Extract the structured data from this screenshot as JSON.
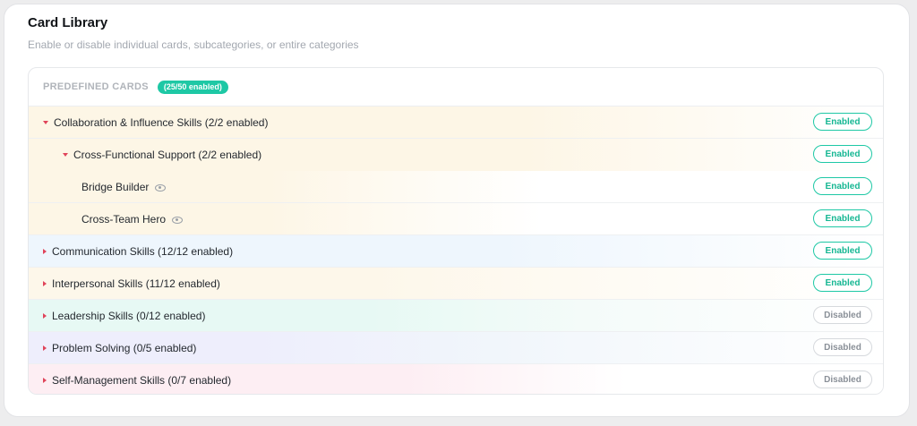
{
  "header": {
    "title": "Card Library",
    "subtitle": "Enable or disable individual cards, subcategories, or entire categories"
  },
  "panel": {
    "header_label": "PREDEFINED CARDS",
    "count_badge": "(25/50 enabled)"
  },
  "colors": {
    "accent": "#1ec8a5",
    "caret": "#e0445a",
    "collaboration_bg": "#fdf6e6",
    "communication_bg": "#eef6fd",
    "interpersonal_bg": "#fdf7ea",
    "leadership_bg": "#e7f9f4",
    "problem_solving_bg": "#eeeefc",
    "self_management_bg": "#fdeef3"
  },
  "rows": [
    {
      "label": "Collaboration & Influence Skills (2/2 enabled)",
      "status": "Enabled",
      "caret": "down-caret-icon"
    },
    {
      "label": "Cross-Functional Support (2/2 enabled)",
      "status": "Enabled",
      "caret": "down-caret-icon"
    },
    {
      "label": "Bridge Builder",
      "status": "Enabled",
      "icon": "eye-icon"
    },
    {
      "label": "Cross-Team Hero",
      "status": "Enabled",
      "icon": "eye-icon"
    },
    {
      "label": "Communication Skills (12/12 enabled)",
      "status": "Enabled",
      "caret": "right-caret-icon"
    },
    {
      "label": "Interpersonal Skills (11/12 enabled)",
      "status": "Enabled",
      "caret": "right-caret-icon"
    },
    {
      "label": "Leadership Skills (0/12 enabled)",
      "status": "Disabled",
      "caret": "right-caret-icon"
    },
    {
      "label": "Problem Solving (0/5 enabled)",
      "status": "Disabled",
      "caret": "right-caret-icon"
    },
    {
      "label": "Self-Management Skills (0/7 enabled)",
      "status": "Disabled",
      "caret": "right-caret-icon"
    }
  ]
}
